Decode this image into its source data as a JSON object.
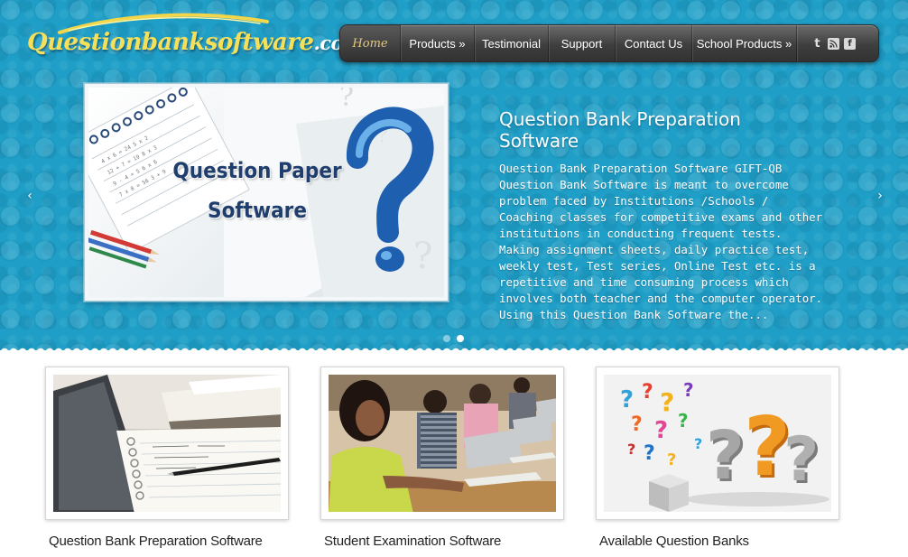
{
  "logo": {
    "main": "Questionbanksoftware",
    "tld": ".com"
  },
  "nav": {
    "items": [
      "Home",
      "Products »",
      "Testimonial",
      "Support",
      "Contact Us",
      "School Products »"
    ],
    "social": [
      "twitter-icon",
      "rss-icon",
      "facebook-icon"
    ]
  },
  "slider": {
    "image_caption_line1": "Question Paper",
    "image_caption_line2": "Software",
    "title": "Question Bank Preparation Software",
    "description": "Question Bank Preparation Software GIFT-QB Question Bank Software is meant to overcome problem faced by Institutions /Schools / Coaching classes for competitive exams and other institutions in conducting frequent tests. Making assignment sheets, daily practice test, weekly test, Test series, Online Test etc. is a repetitive and time consuming process which involves both teacher and the computer operator. Using this Question Bank Software the...",
    "prev_icon": "‹",
    "next_icon": "›",
    "slide_count": 2,
    "active_slide": 2
  },
  "cards": [
    {
      "title": "Question Bank Preparation Software"
    },
    {
      "title": "Student Examination Software"
    },
    {
      "title": "Available Question Banks"
    }
  ],
  "colors": {
    "hero_blue": "#1f9fc7",
    "nav_dark": "#3e3e3e",
    "logo_yellow": "#f6e05a",
    "active_nav": "#e6c77a"
  }
}
